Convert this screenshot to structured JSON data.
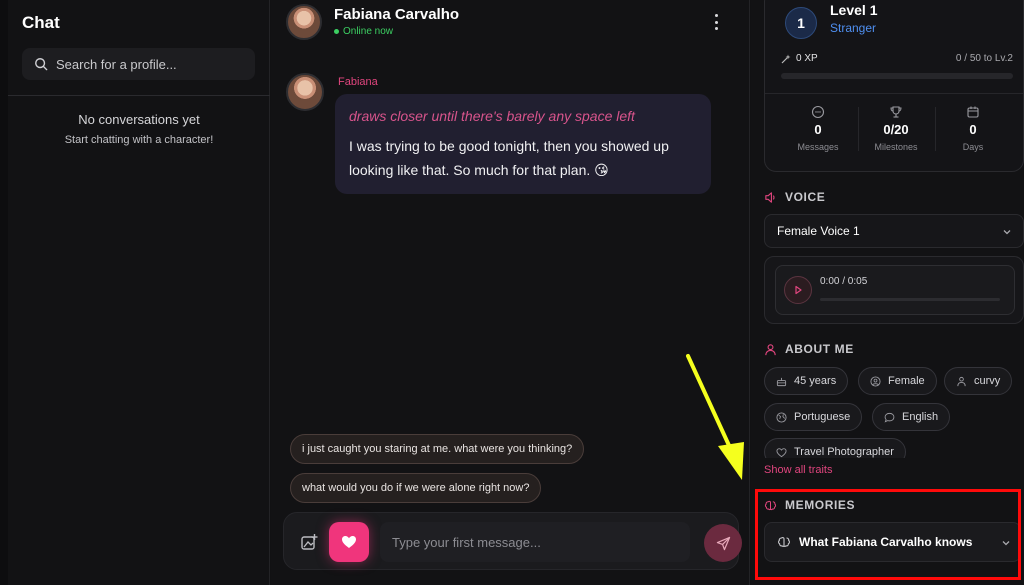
{
  "sidebar": {
    "title": "Chat",
    "search_placeholder": "Search for a profile...",
    "empty_title": "No conversations yet",
    "empty_subtitle": "Start chatting with a character!"
  },
  "chat": {
    "name": "Fabiana Carvalho",
    "status": "Online now",
    "message": {
      "sender": "Fabiana",
      "action": "draws closer until there's barely any space left",
      "text": "I was trying to be good tonight, then you showed up looking like that. So much for that plan. 😘"
    },
    "suggestions": [
      "i just caught you staring at me. what were you thinking?",
      "what would you do if we were alone right now?"
    ],
    "composer_placeholder": "Type your first message..."
  },
  "profile": {
    "level": {
      "number": "1",
      "title": "Level 1",
      "rank": "Stranger",
      "xp": "0 XP",
      "xp_progress": "0 / 50 to Lv.2",
      "xp_fraction": 0
    },
    "stats": [
      {
        "value": "0",
        "label": "Messages"
      },
      {
        "value": "0/20",
        "label": "Milestones"
      },
      {
        "value": "0",
        "label": "Days"
      }
    ],
    "voice": {
      "heading": "VOICE",
      "selected": "Female Voice 1",
      "time": "0:00 / 0:05"
    },
    "about": {
      "heading": "ABOUT ME",
      "traits": [
        "45 years",
        "Female",
        "curvy",
        "Portuguese",
        "English",
        "Travel Photographer"
      ],
      "show_all": "Show all traits"
    },
    "memories": {
      "heading": "MEMORIES",
      "item": "What Fabiana Carvalho knows"
    }
  },
  "colors": {
    "accent": "#f0357c",
    "online": "#3ccf62",
    "level_blue": "#4f8ff0",
    "highlight_box": "#ff0a0a",
    "arrow": "#f5ff1e"
  }
}
